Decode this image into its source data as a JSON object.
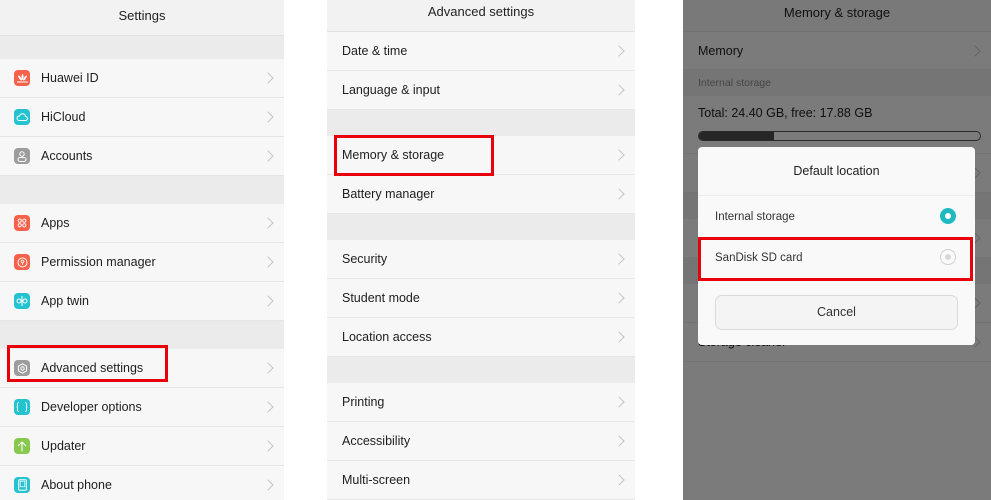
{
  "settings": {
    "title": "Settings",
    "groups": [
      [
        {
          "label": "Huawei ID",
          "icon": "huawei-logo-icon",
          "color": "#f5614a"
        },
        {
          "label": "HiCloud",
          "icon": "cloud-icon",
          "color": "#25c2cf"
        },
        {
          "label": "Accounts",
          "icon": "person-icon",
          "color": "#9c9c9c"
        }
      ],
      [
        {
          "label": "Apps",
          "icon": "apps-grid-icon",
          "color": "#f5614a"
        },
        {
          "label": "Permission manager",
          "icon": "permission-icon",
          "color": "#f5614a"
        },
        {
          "label": "App twin",
          "icon": "app-twin-icon",
          "color": "#25c2cf"
        }
      ],
      [
        {
          "label": "Advanced settings",
          "icon": "gear-icon",
          "color": "#9c9c9c"
        },
        {
          "label": "Developer options",
          "icon": "braces-icon",
          "color": "#25c2cf"
        },
        {
          "label": "Updater",
          "icon": "arrow-up-icon",
          "color": "#86c94d"
        },
        {
          "label": "About phone",
          "icon": "phone-icon",
          "color": "#25c2cf"
        }
      ]
    ]
  },
  "advanced": {
    "title": "Advanced settings",
    "groups": [
      [
        {
          "label": "Date & time"
        },
        {
          "label": "Language & input"
        }
      ],
      [
        {
          "label": "Memory & storage"
        },
        {
          "label": "Battery manager"
        }
      ],
      [
        {
          "label": "Security"
        },
        {
          "label": "Student mode"
        },
        {
          "label": "Location access"
        }
      ],
      [
        {
          "label": "Printing"
        },
        {
          "label": "Accessibility"
        },
        {
          "label": "Multi-screen"
        }
      ]
    ]
  },
  "memory": {
    "title": "Memory & storage",
    "memory_label": "Memory",
    "internal_storage_header": "Internal storage",
    "total_text": "Total: 24.40 GB, free: 17.88 GB",
    "used_fraction": 0.267,
    "storage_cleaner_label": "Storage cleaner",
    "dialog": {
      "title": "Default location",
      "options": [
        {
          "label": "Internal storage",
          "selected": true
        },
        {
          "label": "SanDisk SD card",
          "selected": false
        }
      ],
      "cancel_label": "Cancel"
    }
  },
  "colors": {
    "highlight": "#e8000b",
    "accent": "#1fb9c4"
  }
}
